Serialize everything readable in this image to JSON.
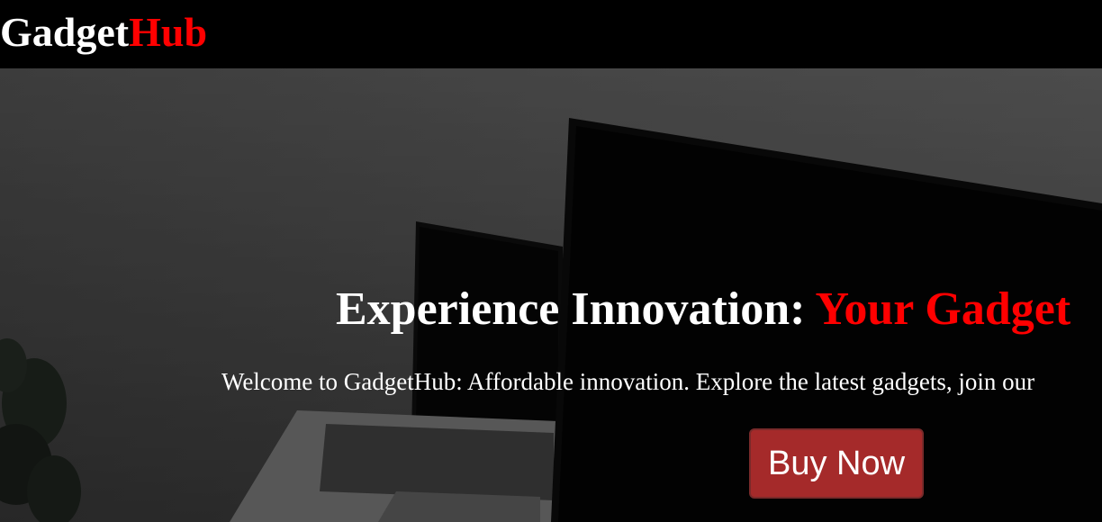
{
  "header": {
    "brand_part1": "Gadget",
    "brand_part2": "Hub"
  },
  "hero": {
    "title_part1": "Experience Innovation: ",
    "title_part2": "Your Gadget",
    "subtitle": "Welcome to GadgetHub: Affordable innovation. Explore the latest gadgets, join our",
    "cta_label": "Buy Now",
    "background_image": "laptop-and-monitor-photo"
  },
  "colors": {
    "header_bg": "#000000",
    "brand_accent": "#ff0000",
    "text": "#ffffff",
    "button_bg": "#a52a2a"
  }
}
